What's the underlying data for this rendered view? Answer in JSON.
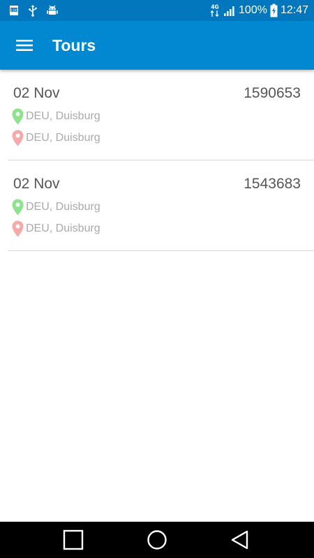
{
  "status_bar": {
    "network_label": "4G",
    "battery_percent": "100%",
    "time": "12:47",
    "icons": [
      "storage-100-icon",
      "usb-icon",
      "android-debug-icon",
      "mobile-data-icon",
      "signal-icon",
      "battery-charging-icon"
    ]
  },
  "app_bar": {
    "title": "Tours",
    "menu_icon": "hamburger-menu-icon",
    "background_color": "#0288d1"
  },
  "tours": [
    {
      "date": "02 Nov",
      "id": "1590653",
      "origin": "DEU, Duisburg",
      "destination": "DEU, Duisburg"
    },
    {
      "date": "02 Nov",
      "id": "1543683",
      "origin": "DEU, Duisburg",
      "destination": "DEU, Duisburg"
    }
  ],
  "colors": {
    "origin_pin": "#8ee28e",
    "destination_pin": "#f5a9a9",
    "status_bar": "#0277bd"
  },
  "nav_bar": {
    "buttons": [
      "recent-apps-icon",
      "home-icon",
      "back-icon"
    ]
  }
}
